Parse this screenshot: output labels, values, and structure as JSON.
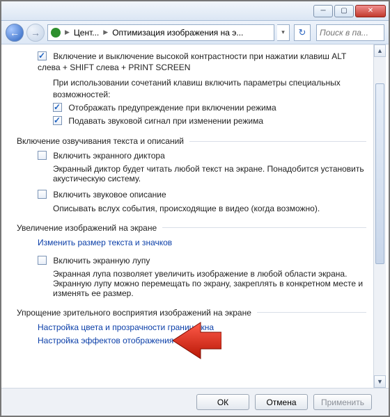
{
  "breadcrumb": {
    "seg1": "Цент...",
    "seg2": "Оптимизация изображения на э..."
  },
  "search_placeholder": "Поиск в па...",
  "contrast": {
    "main": "Включение и выключение высокой контрастности при нажатии клавиш ALT слева + SHIFT слева + PRINT SCREEN",
    "sub_intro": "При использовании сочетаний клавиш включить параметры специальных возможностей:",
    "opt1": "Отображать предупреждение при включении режима",
    "opt2": "Подавать звуковой сигнал при изменении режима"
  },
  "narration": {
    "heading": "Включение озвучивания текста и описаний",
    "narrator_cb": "Включить экранного диктора",
    "narrator_desc": "Экранный диктор будет читать любой текст на экране. Понадобится установить акустическую систему.",
    "audio_cb": "Включить звуковое описание",
    "audio_desc": "Описывать вслух события, происходящие в видео (когда возможно)."
  },
  "magnify": {
    "heading": "Увеличение изображений на экране",
    "link": "Изменить размер текста и значков",
    "cb": "Включить экранную лупу",
    "desc": "Экранная лупа позволяет увеличить изображение в любой области экрана. Экранную лупу можно перемещать по экрану, закреплять в конкретном месте и изменять ее размер."
  },
  "simplify": {
    "heading": "Упрощение зрительного восприятия изображений на экране",
    "link1": "Настройка цвета и прозрачности границ окна",
    "link2": "Настройка эффектов отображения"
  },
  "buttons": {
    "ok": "ОК",
    "cancel": "Отмена",
    "apply": "Применить"
  }
}
